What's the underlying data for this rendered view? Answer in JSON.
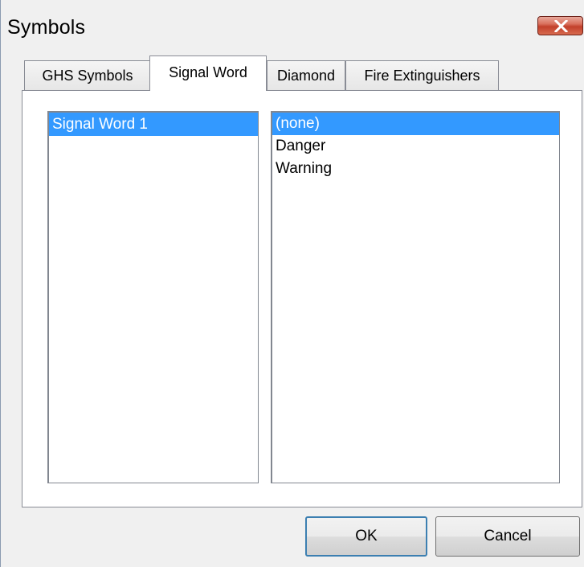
{
  "window": {
    "title": "Symbols",
    "close_icon": "close-x-icon"
  },
  "tabs": [
    {
      "label": "GHS Symbols",
      "active": false
    },
    {
      "label": "Signal Word",
      "active": true
    },
    {
      "label": "Diamond",
      "active": false
    },
    {
      "label": "Fire Extinguishers",
      "active": false
    }
  ],
  "left_list": {
    "items": [
      {
        "label": "Signal Word 1",
        "selected": true
      }
    ]
  },
  "right_list": {
    "items": [
      {
        "label": "(none)",
        "selected": true
      },
      {
        "label": "Danger",
        "selected": false
      },
      {
        "label": "Warning",
        "selected": false
      }
    ]
  },
  "buttons": {
    "ok_label": "OK",
    "cancel_label": "Cancel"
  },
  "colors": {
    "selection": "#3399ff",
    "close_button": "#c2402c",
    "dialog_background": "#f0f0f0"
  }
}
